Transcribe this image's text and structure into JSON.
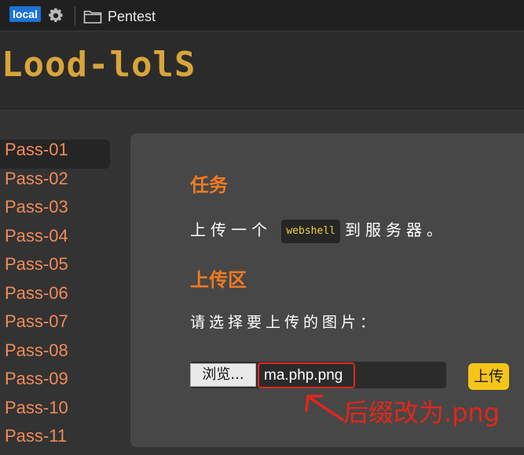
{
  "bookmarks": {
    "badge": "local",
    "folder_label": "Pentest",
    "icons": [
      "settings-gear-icon",
      "folder-icon"
    ]
  },
  "header": {
    "logo_text": "Lood-lolS"
  },
  "sidebar": {
    "items": [
      {
        "label": "Pass-01",
        "active": true
      },
      {
        "label": "Pass-02"
      },
      {
        "label": "Pass-03"
      },
      {
        "label": "Pass-04"
      },
      {
        "label": "Pass-05"
      },
      {
        "label": "Pass-06"
      },
      {
        "label": "Pass-07"
      },
      {
        "label": "Pass-08"
      },
      {
        "label": "Pass-09"
      },
      {
        "label": "Pass-10"
      },
      {
        "label": "Pass-11"
      }
    ]
  },
  "task": {
    "title": "任务",
    "text_before": "上传一个",
    "code": "webshell",
    "text_after": "到服务器。"
  },
  "upload": {
    "title": "上传区",
    "prompt": "请选择要上传的图片：",
    "browse_label": "浏览...",
    "filename": "ma.php.png",
    "submit_label": "上传"
  },
  "annotation": {
    "text": "后缀改为.png",
    "color": "#e0271b"
  },
  "colors": {
    "accent_orange": "#f07a23",
    "link_salmon": "#f08b5a",
    "logo_gold": "#d8a53a",
    "upload_yellow": "#f5c518"
  }
}
